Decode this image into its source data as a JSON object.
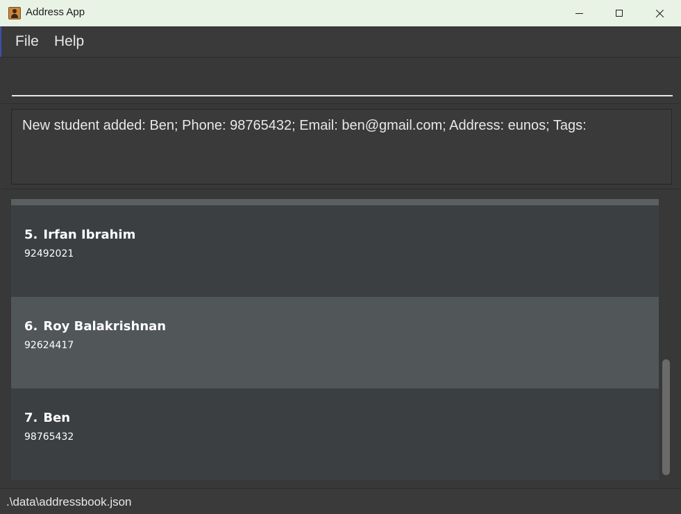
{
  "window": {
    "title": "Address App",
    "icon": "address-book-icon"
  },
  "menu": {
    "file_label": "File",
    "help_label": "Help"
  },
  "command_box": {
    "value": "",
    "placeholder": ""
  },
  "result_display": {
    "text": "New student added: Ben; Phone: 98765432; Email: ben@gmail.com; Address: eunos; Tags:"
  },
  "person_list": [
    {
      "index": "5.",
      "name": "Irfan Ibrahim",
      "phone": "92492021"
    },
    {
      "index": "6.",
      "name": "Roy Balakrishnan",
      "phone": "92624417"
    },
    {
      "index": "7.",
      "name": "Ben",
      "phone": "98765432"
    }
  ],
  "status_bar": {
    "save_location": ".\\data\\addressbook.json"
  },
  "colors": {
    "title_bar": "#e8f3e6",
    "background": "#383838",
    "card_odd": "#3c3f41",
    "card_even": "#515658"
  }
}
